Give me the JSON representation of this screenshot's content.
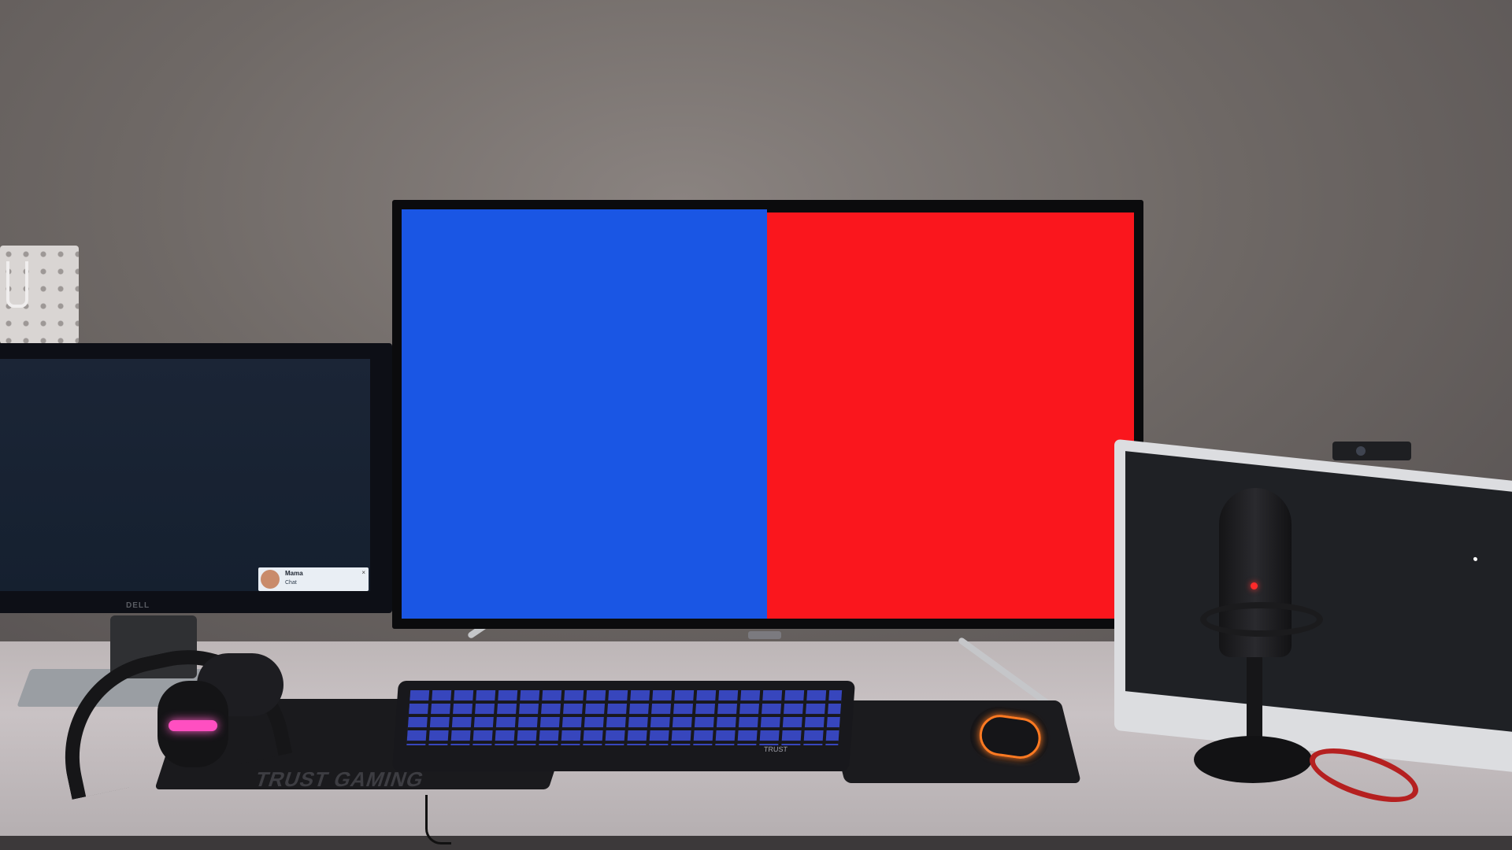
{
  "scene": {
    "description_label": ""
  },
  "left_monitor": {
    "brand": "DELL",
    "notification": {
      "name": "Mama",
      "message": "Chat",
      "close": "×"
    }
  },
  "main_monitor": {
    "left_color": "#1a56e4",
    "right_color": "#fa161d"
  },
  "mousepad": {
    "brand_text": "TRUST GAMING"
  },
  "keyboard": {
    "brand_text": "TRUST"
  },
  "colors": {
    "headphone_glow": "#ff4fc1",
    "mouse_glow": "#ff7a22",
    "mic_led": "#ff2a2a"
  }
}
